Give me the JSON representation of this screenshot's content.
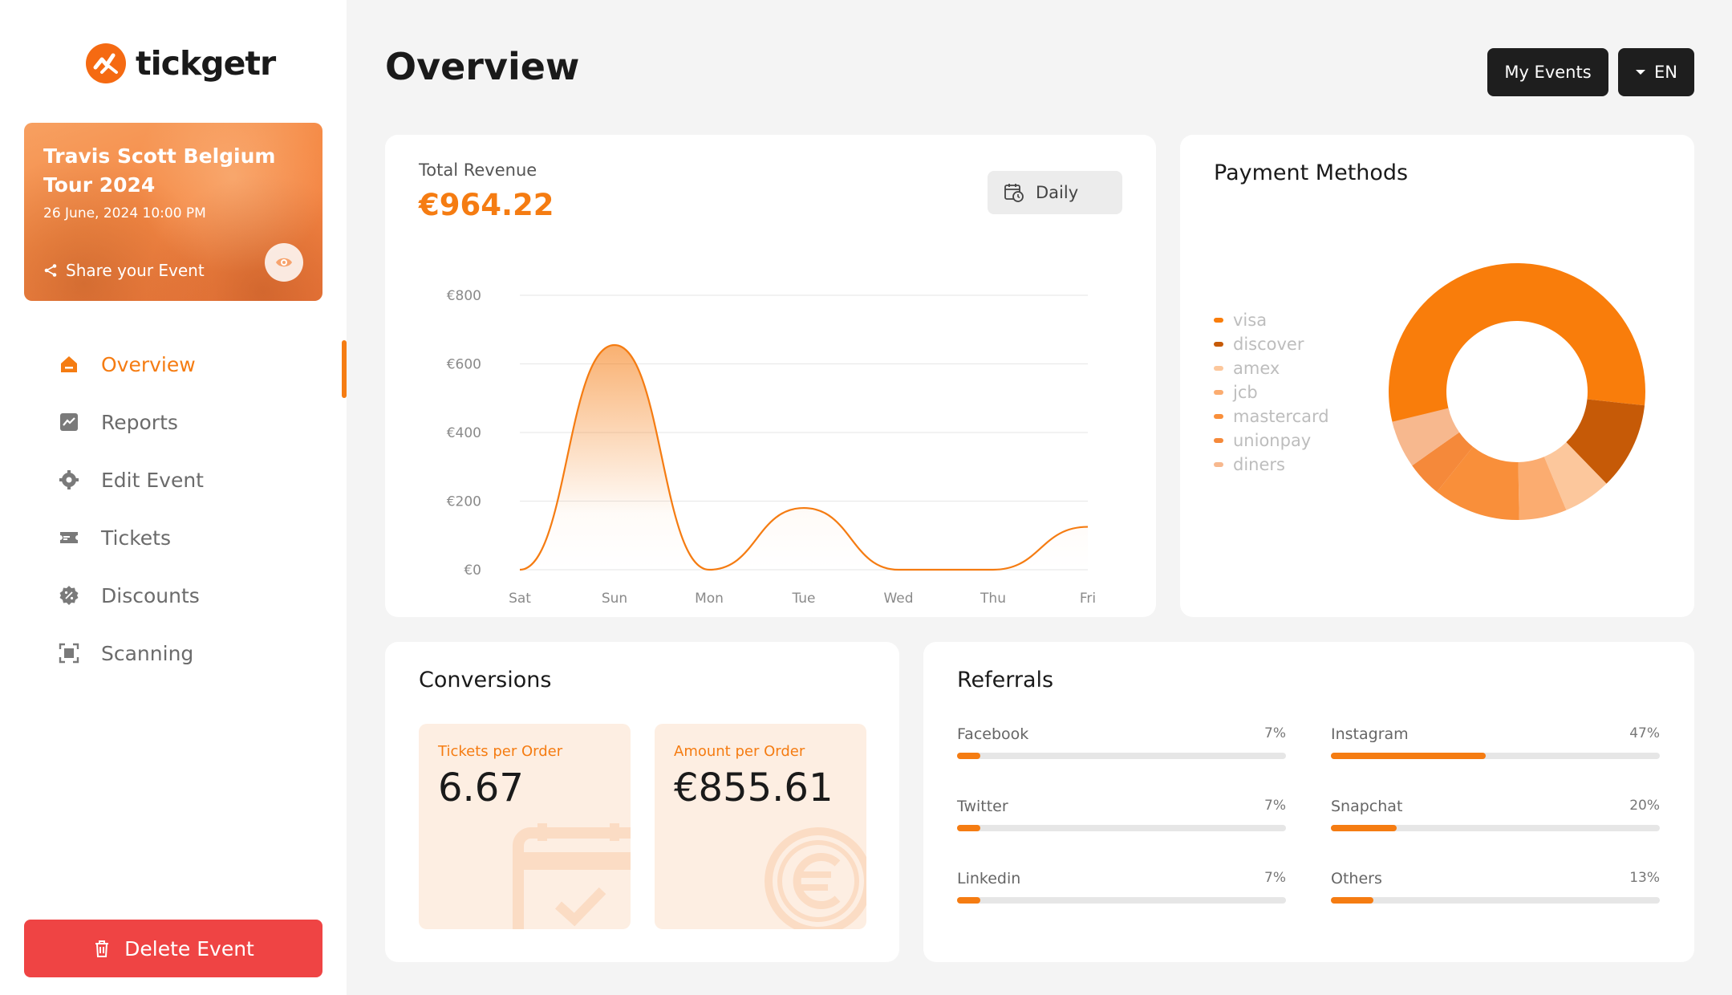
{
  "brand": {
    "name": "tickgetr",
    "accent": "#f57c12"
  },
  "event": {
    "title": "Travis Scott Belgium Tour 2024",
    "date": "26 June, 2024 10:00 PM",
    "share_label": "Share your Event"
  },
  "nav": {
    "items": [
      {
        "label": "Overview",
        "icon": "home-icon",
        "active": true
      },
      {
        "label": "Reports",
        "icon": "chart-icon",
        "active": false
      },
      {
        "label": "Edit Event",
        "icon": "gear-icon",
        "active": false
      },
      {
        "label": "Tickets",
        "icon": "ticket-icon",
        "active": false
      },
      {
        "label": "Discounts",
        "icon": "discount-icon",
        "active": false
      },
      {
        "label": "Scanning",
        "icon": "scan-icon",
        "active": false
      }
    ]
  },
  "delete_label": "Delete Event",
  "header": {
    "title": "Overview",
    "my_events_label": "My Events",
    "language_label": "EN"
  },
  "revenue": {
    "label": "Total Revenue",
    "value": "€964.22",
    "period_label": "Daily"
  },
  "chart_data": {
    "type": "area",
    "title": "",
    "xlabel": "",
    "ylabel": "",
    "categories": [
      "Sat",
      "Sun",
      "Mon",
      "Tue",
      "Wed",
      "Thu",
      "Fri"
    ],
    "series": [
      {
        "values": [
          0,
          655,
          0,
          180,
          0,
          0,
          125
        ]
      }
    ],
    "ylim": [
      0,
      800
    ],
    "y_ticks": [
      "€0",
      "€200",
      "€400",
      "€600",
      "€800"
    ],
    "grid": true,
    "color": "#f57c12"
  },
  "payment": {
    "title": "Payment Methods",
    "methods": [
      {
        "name": "visa",
        "share": 0.565,
        "color": "#f97d0b"
      },
      {
        "name": "discover",
        "share": 0.11,
        "color": "#c65a07"
      },
      {
        "name": "amex",
        "share": 0.06,
        "color": "#fcc79c"
      },
      {
        "name": "jcb",
        "share": 0.06,
        "color": "#fbac70"
      },
      {
        "name": "mastercard",
        "share": 0.11,
        "color": "#f98f3a"
      },
      {
        "name": "unionpay",
        "share": 0.045,
        "color": "#f5893a"
      },
      {
        "name": "diners",
        "share": 0.06,
        "color": "#f7b88e"
      }
    ]
  },
  "conversions": {
    "title": "Conversions",
    "tickets_per_order_label": "Tickets per Order",
    "tickets_per_order": "6.67",
    "amount_per_order_label": "Amount per Order",
    "amount_per_order": "€855.61"
  },
  "referrals": {
    "title": "Referrals",
    "items": [
      {
        "name": "Facebook",
        "pct_label": "7%",
        "pct": 7
      },
      {
        "name": "Instagram",
        "pct_label": "47%",
        "pct": 47
      },
      {
        "name": "Twitter",
        "pct_label": "7%",
        "pct": 7
      },
      {
        "name": "Snapchat",
        "pct_label": "20%",
        "pct": 20
      },
      {
        "name": "Linkedin",
        "pct_label": "7%",
        "pct": 7
      },
      {
        "name": "Others",
        "pct_label": "13%",
        "pct": 13
      }
    ]
  }
}
